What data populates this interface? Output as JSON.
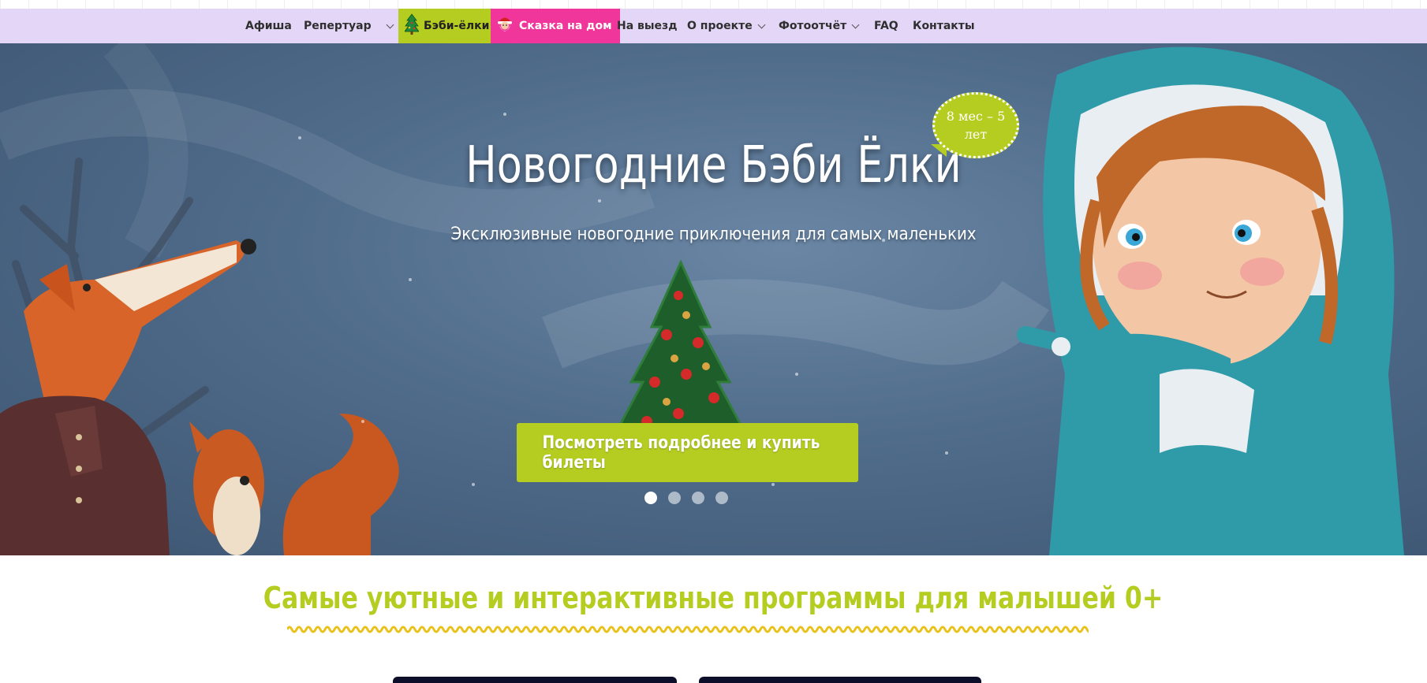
{
  "nav": {
    "items": [
      {
        "label": "Афиша"
      },
      {
        "label": "Репертуар"
      },
      {
        "label": "Бэби-ёлки"
      },
      {
        "label": "Сказка на дом"
      },
      {
        "label": "На выезд"
      },
      {
        "label": "О проекте"
      },
      {
        "label": "Фотоотчёт"
      },
      {
        "label": "FAQ"
      },
      {
        "label": "Контакты"
      }
    ]
  },
  "hero": {
    "title": "Новогодние Бэби Ёлки",
    "age_badge": "8 мес – 5 лет",
    "subtitle": "Эксклюзивные новогодние приключения для самых маленьких",
    "cta_label": "Посмотреть подробнее и купить билеты",
    "slides_count": 4,
    "active_slide": 1
  },
  "section": {
    "title": "Самые уютные и интерактивные программы для малышей 0+"
  },
  "colors": {
    "nav_bg": "#e3d6f7",
    "accent_green": "#b5cd21",
    "accent_pink": "#f0369a",
    "hero_bg": "#506c8b"
  },
  "icons": {
    "baby_trees": "fir-tree-icon",
    "fairy_tale": "santa-icon",
    "dropdown": "chevron-down-icon"
  }
}
